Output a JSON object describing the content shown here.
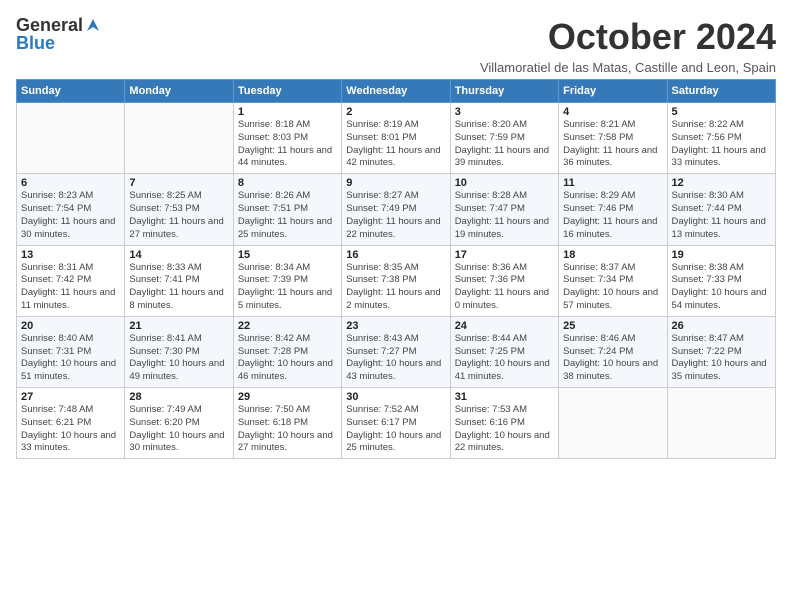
{
  "logo": {
    "general": "General",
    "blue": "Blue"
  },
  "title": "October 2024",
  "subtitle": "Villamoratiel de las Matas, Castille and Leon, Spain",
  "headers": [
    "Sunday",
    "Monday",
    "Tuesday",
    "Wednesday",
    "Thursday",
    "Friday",
    "Saturday"
  ],
  "weeks": [
    [
      {
        "day": "",
        "detail": ""
      },
      {
        "day": "",
        "detail": ""
      },
      {
        "day": "1",
        "detail": "Sunrise: 8:18 AM\nSunset: 8:03 PM\nDaylight: 11 hours and 44 minutes."
      },
      {
        "day": "2",
        "detail": "Sunrise: 8:19 AM\nSunset: 8:01 PM\nDaylight: 11 hours and 42 minutes."
      },
      {
        "day": "3",
        "detail": "Sunrise: 8:20 AM\nSunset: 7:59 PM\nDaylight: 11 hours and 39 minutes."
      },
      {
        "day": "4",
        "detail": "Sunrise: 8:21 AM\nSunset: 7:58 PM\nDaylight: 11 hours and 36 minutes."
      },
      {
        "day": "5",
        "detail": "Sunrise: 8:22 AM\nSunset: 7:56 PM\nDaylight: 11 hours and 33 minutes."
      }
    ],
    [
      {
        "day": "6",
        "detail": "Sunrise: 8:23 AM\nSunset: 7:54 PM\nDaylight: 11 hours and 30 minutes."
      },
      {
        "day": "7",
        "detail": "Sunrise: 8:25 AM\nSunset: 7:53 PM\nDaylight: 11 hours and 27 minutes."
      },
      {
        "day": "8",
        "detail": "Sunrise: 8:26 AM\nSunset: 7:51 PM\nDaylight: 11 hours and 25 minutes."
      },
      {
        "day": "9",
        "detail": "Sunrise: 8:27 AM\nSunset: 7:49 PM\nDaylight: 11 hours and 22 minutes."
      },
      {
        "day": "10",
        "detail": "Sunrise: 8:28 AM\nSunset: 7:47 PM\nDaylight: 11 hours and 19 minutes."
      },
      {
        "day": "11",
        "detail": "Sunrise: 8:29 AM\nSunset: 7:46 PM\nDaylight: 11 hours and 16 minutes."
      },
      {
        "day": "12",
        "detail": "Sunrise: 8:30 AM\nSunset: 7:44 PM\nDaylight: 11 hours and 13 minutes."
      }
    ],
    [
      {
        "day": "13",
        "detail": "Sunrise: 8:31 AM\nSunset: 7:42 PM\nDaylight: 11 hours and 11 minutes."
      },
      {
        "day": "14",
        "detail": "Sunrise: 8:33 AM\nSunset: 7:41 PM\nDaylight: 11 hours and 8 minutes."
      },
      {
        "day": "15",
        "detail": "Sunrise: 8:34 AM\nSunset: 7:39 PM\nDaylight: 11 hours and 5 minutes."
      },
      {
        "day": "16",
        "detail": "Sunrise: 8:35 AM\nSunset: 7:38 PM\nDaylight: 11 hours and 2 minutes."
      },
      {
        "day": "17",
        "detail": "Sunrise: 8:36 AM\nSunset: 7:36 PM\nDaylight: 11 hours and 0 minutes."
      },
      {
        "day": "18",
        "detail": "Sunrise: 8:37 AM\nSunset: 7:34 PM\nDaylight: 10 hours and 57 minutes."
      },
      {
        "day": "19",
        "detail": "Sunrise: 8:38 AM\nSunset: 7:33 PM\nDaylight: 10 hours and 54 minutes."
      }
    ],
    [
      {
        "day": "20",
        "detail": "Sunrise: 8:40 AM\nSunset: 7:31 PM\nDaylight: 10 hours and 51 minutes."
      },
      {
        "day": "21",
        "detail": "Sunrise: 8:41 AM\nSunset: 7:30 PM\nDaylight: 10 hours and 49 minutes."
      },
      {
        "day": "22",
        "detail": "Sunrise: 8:42 AM\nSunset: 7:28 PM\nDaylight: 10 hours and 46 minutes."
      },
      {
        "day": "23",
        "detail": "Sunrise: 8:43 AM\nSunset: 7:27 PM\nDaylight: 10 hours and 43 minutes."
      },
      {
        "day": "24",
        "detail": "Sunrise: 8:44 AM\nSunset: 7:25 PM\nDaylight: 10 hours and 41 minutes."
      },
      {
        "day": "25",
        "detail": "Sunrise: 8:46 AM\nSunset: 7:24 PM\nDaylight: 10 hours and 38 minutes."
      },
      {
        "day": "26",
        "detail": "Sunrise: 8:47 AM\nSunset: 7:22 PM\nDaylight: 10 hours and 35 minutes."
      }
    ],
    [
      {
        "day": "27",
        "detail": "Sunrise: 7:48 AM\nSunset: 6:21 PM\nDaylight: 10 hours and 33 minutes."
      },
      {
        "day": "28",
        "detail": "Sunrise: 7:49 AM\nSunset: 6:20 PM\nDaylight: 10 hours and 30 minutes."
      },
      {
        "day": "29",
        "detail": "Sunrise: 7:50 AM\nSunset: 6:18 PM\nDaylight: 10 hours and 27 minutes."
      },
      {
        "day": "30",
        "detail": "Sunrise: 7:52 AM\nSunset: 6:17 PM\nDaylight: 10 hours and 25 minutes."
      },
      {
        "day": "31",
        "detail": "Sunrise: 7:53 AM\nSunset: 6:16 PM\nDaylight: 10 hours and 22 minutes."
      },
      {
        "day": "",
        "detail": ""
      },
      {
        "day": "",
        "detail": ""
      }
    ]
  ]
}
